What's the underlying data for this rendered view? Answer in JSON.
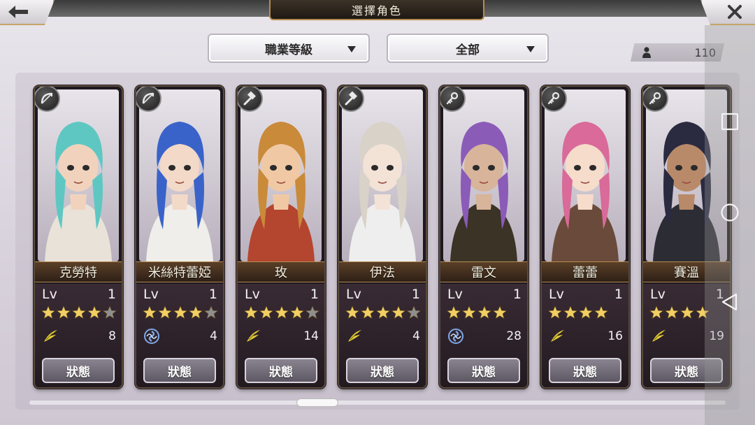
{
  "header": {
    "title": "選擇角色",
    "back_icon": "back-arrow-icon",
    "close_icon": "close-x-icon"
  },
  "filters": {
    "class_level": "職業等級",
    "category": "全部"
  },
  "character_count": "110",
  "characters": [
    {
      "name": "克勞特",
      "lv_label": "Lv",
      "level": "1",
      "stars": 4,
      "max_stars": 5,
      "attr": "wind",
      "count": "8",
      "class_icon": "bow-icon",
      "status_label": "狀態",
      "hair": "#5fc7c2",
      "skin": "#f1d3bd",
      "outfit": "#e8e2d8"
    },
    {
      "name": "米絲特蕾婭",
      "lv_label": "Lv",
      "level": "1",
      "stars": 4,
      "max_stars": 5,
      "attr": "water",
      "count": "4",
      "class_icon": "bow-icon",
      "status_label": "狀態",
      "hair": "#3a63c9",
      "skin": "#f3d9c8",
      "outfit": "#f0eeea"
    },
    {
      "name": "玫",
      "lv_label": "Lv",
      "level": "1",
      "stars": 4,
      "max_stars": 5,
      "attr": "wind",
      "count": "14",
      "class_icon": "hammer-icon",
      "status_label": "狀態",
      "hair": "#c98a3a",
      "skin": "#f0c9a4",
      "outfit": "#b4452f"
    },
    {
      "name": "伊法",
      "lv_label": "Lv",
      "level": "1",
      "stars": 4,
      "max_stars": 5,
      "attr": "wind",
      "count": "4",
      "class_icon": "hammer-icon",
      "status_label": "狀態",
      "hair": "#d8d2c8",
      "skin": "#f3e2d6",
      "outfit": "#efeeee"
    },
    {
      "name": "雷文",
      "lv_label": "Lv",
      "level": "1",
      "stars": 4,
      "max_stars": 4,
      "attr": "water",
      "count": "28",
      "class_icon": "key-icon",
      "status_label": "狀態",
      "hair": "#8b5bb8",
      "skin": "#d8b49a",
      "outfit": "#3a3326"
    },
    {
      "name": "蕾蕾",
      "lv_label": "Lv",
      "level": "1",
      "stars": 4,
      "max_stars": 4,
      "attr": "wind",
      "count": "16",
      "class_icon": "key-icon",
      "status_label": "狀態",
      "hair": "#d96a9a",
      "skin": "#f6dccb",
      "outfit": "#6a4a3a"
    },
    {
      "name": "賽溫",
      "lv_label": "Lv",
      "level": "1",
      "stars": 4,
      "max_stars": 4,
      "attr": "wind",
      "count": "19",
      "class_icon": "key-icon",
      "status_label": "狀態",
      "hair": "#2a2a40",
      "skin": "#b88a6a",
      "outfit": "#2c2c34"
    }
  ],
  "colors": {
    "star_gold": "#f1cf63",
    "star_gray": "#8f8f8f",
    "wind": "#e7d23a",
    "water": "#7fa8e8",
    "frame_gold": "#b48c4e"
  },
  "nav": {
    "recents_icon": "square-icon",
    "home_icon": "circle-icon",
    "back_icon": "triangle-icon"
  }
}
